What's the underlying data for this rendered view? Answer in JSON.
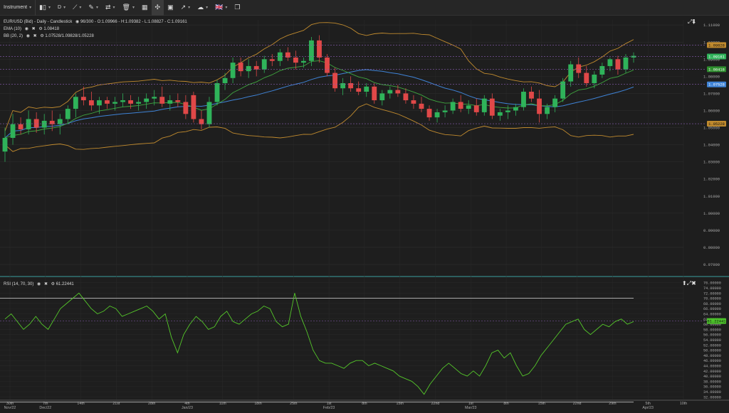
{
  "toolbar": {
    "instrument": "Instrument",
    "timeframe": "D",
    "flag": "🇬🇧"
  },
  "legend": {
    "title": "EUR/USD (Bid) - Daily - Candlestick",
    "bars": "96/300",
    "ohlc": "O:1.09966 - H:1.09382 - L:1.08827 - C:1.09161",
    "ema_label": "EMA (10)",
    "ema_value": "1.08418",
    "bb_label": "BB (20, 2)",
    "bb_value": "1.07528/1.09828/1.05228",
    "rsi_label": "RSI (14, 70, 30)",
    "rsi_value": "61.22441"
  },
  "price_axis": {
    "ticks": [
      "1.11000",
      "1.10000",
      "1.09000",
      "1.08000",
      "1.07000",
      "1.06000",
      "1.05000",
      "1.04000",
      "1.03000",
      "1.02000",
      "1.01000",
      "1.00000",
      "0.99000",
      "0.98000",
      "0.97000"
    ],
    "bb_upper": "1.09828",
    "last": "1.09161",
    "ema": "1.08418",
    "bb_mid": "1.07528",
    "bb_lower": "1.05228"
  },
  "rsi_axis": {
    "ticks": [
      "76.00000",
      "74.00000",
      "72.00000",
      "70.00000",
      "68.00000",
      "66.00000",
      "64.00000",
      "62.00000",
      "60.00000",
      "58.00000",
      "56.00000",
      "54.00000",
      "52.00000",
      "50.00000",
      "48.00000",
      "46.00000",
      "44.00000",
      "42.00000",
      "40.00000",
      "38.00000",
      "36.00000",
      "34.00000",
      "32.00000"
    ],
    "current": "61.22441"
  },
  "time_axis": [
    {
      "label": "30th\nNov/22"
    },
    {
      "label": "7th\nDec/22"
    },
    {
      "label": "14th"
    },
    {
      "label": "21st"
    },
    {
      "label": "28th"
    },
    {
      "label": "4th\nJan/23"
    },
    {
      "label": "11th"
    },
    {
      "label": "18th"
    },
    {
      "label": "25th"
    },
    {
      "label": "1st\nFeb/23"
    },
    {
      "label": "8th"
    },
    {
      "label": "15th"
    },
    {
      "label": "22nd"
    },
    {
      "label": "1st\nMar/23"
    },
    {
      "label": "8th"
    },
    {
      "label": "15th"
    },
    {
      "label": "22nd"
    },
    {
      "label": "29th"
    },
    {
      "label": "5th\nApr/23"
    },
    {
      "label": "10th"
    }
  ],
  "colors": {
    "up": "#2fb35a",
    "down": "#e04848",
    "ema": "#3fa63f",
    "bb_band": "#c08a2e",
    "bb_mid": "#3f83d6",
    "rsi": "#55c82a",
    "accent_teal": "#3aa0a0"
  },
  "chart_data": {
    "type": "candlestick",
    "price_range": [
      0.965,
      1.113
    ],
    "rsi_range": [
      31,
      77
    ],
    "rsi_levels": [
      70,
      30
    ],
    "candles": [
      [
        1.036,
        1.05,
        1.03,
        1.044
      ],
      [
        1.044,
        1.058,
        1.04,
        1.052
      ],
      [
        1.052,
        1.056,
        1.046,
        1.049
      ],
      [
        1.049,
        1.06,
        1.046,
        1.055
      ],
      [
        1.055,
        1.059,
        1.047,
        1.05
      ],
      [
        1.05,
        1.058,
        1.046,
        1.054
      ],
      [
        1.054,
        1.06,
        1.048,
        1.052
      ],
      [
        1.052,
        1.058,
        1.046,
        1.055
      ],
      [
        1.055,
        1.063,
        1.052,
        1.061
      ],
      [
        1.061,
        1.07,
        1.056,
        1.068
      ],
      [
        1.068,
        1.074,
        1.063,
        1.066
      ],
      [
        1.066,
        1.071,
        1.06,
        1.063
      ],
      [
        1.063,
        1.068,
        1.058,
        1.066
      ],
      [
        1.066,
        1.068,
        1.061,
        1.064
      ],
      [
        1.064,
        1.068,
        1.06,
        1.065
      ],
      [
        1.065,
        1.07,
        1.062,
        1.066
      ],
      [
        1.066,
        1.069,
        1.061,
        1.064
      ],
      [
        1.064,
        1.068,
        1.06,
        1.065
      ],
      [
        1.065,
        1.07,
        1.061,
        1.067
      ],
      [
        1.067,
        1.072,
        1.063,
        1.068
      ],
      [
        1.068,
        1.074,
        1.062,
        1.064
      ],
      [
        1.064,
        1.069,
        1.06,
        1.066
      ],
      [
        1.066,
        1.07,
        1.062,
        1.065
      ],
      [
        1.065,
        1.069,
        1.055,
        1.058
      ],
      [
        1.069,
        1.071,
        1.053,
        1.055
      ],
      [
        1.055,
        1.06,
        1.049,
        1.052
      ],
      [
        1.052,
        1.068,
        1.05,
        1.065
      ],
      [
        1.065,
        1.078,
        1.063,
        1.076
      ],
      [
        1.076,
        1.082,
        1.072,
        1.079
      ],
      [
        1.079,
        1.091,
        1.076,
        1.088
      ],
      [
        1.088,
        1.091,
        1.08,
        1.083
      ],
      [
        1.083,
        1.09,
        1.079,
        1.086
      ],
      [
        1.086,
        1.089,
        1.08,
        1.084
      ],
      [
        1.084,
        1.092,
        1.082,
        1.09
      ],
      [
        1.09,
        1.093,
        1.086,
        1.089
      ],
      [
        1.089,
        1.096,
        1.086,
        1.094
      ],
      [
        1.094,
        1.097,
        1.089,
        1.091
      ],
      [
        1.091,
        1.095,
        1.084,
        1.088
      ],
      [
        1.088,
        1.091,
        1.085,
        1.089
      ],
      [
        1.089,
        1.103,
        1.086,
        1.101
      ],
      [
        1.101,
        1.104,
        1.088,
        1.091
      ],
      [
        1.091,
        1.093,
        1.08,
        1.082
      ],
      [
        1.082,
        1.085,
        1.071,
        1.073
      ],
      [
        1.073,
        1.079,
        1.069,
        1.076
      ],
      [
        1.076,
        1.08,
        1.071,
        1.073
      ],
      [
        1.073,
        1.077,
        1.069,
        1.071
      ],
      [
        1.071,
        1.076,
        1.068,
        1.074
      ],
      [
        1.074,
        1.076,
        1.064,
        1.066
      ],
      [
        1.066,
        1.072,
        1.063,
        1.07
      ],
      [
        1.07,
        1.074,
        1.067,
        1.072
      ],
      [
        1.072,
        1.075,
        1.068,
        1.07
      ],
      [
        1.07,
        1.073,
        1.064,
        1.066
      ],
      [
        1.066,
        1.069,
        1.061,
        1.064
      ],
      [
        1.064,
        1.068,
        1.059,
        1.061
      ],
      [
        1.061,
        1.063,
        1.054,
        1.056
      ],
      [
        1.056,
        1.061,
        1.053,
        1.059
      ],
      [
        1.059,
        1.063,
        1.056,
        1.06
      ],
      [
        1.06,
        1.067,
        1.058,
        1.065
      ],
      [
        1.065,
        1.069,
        1.059,
        1.061
      ],
      [
        1.061,
        1.066,
        1.058,
        1.063
      ],
      [
        1.063,
        1.067,
        1.057,
        1.059
      ],
      [
        1.059,
        1.069,
        1.057,
        1.067
      ],
      [
        1.067,
        1.07,
        1.055,
        1.057
      ],
      [
        1.057,
        1.061,
        1.054,
        1.059
      ],
      [
        1.059,
        1.063,
        1.055,
        1.06
      ],
      [
        1.06,
        1.064,
        1.057,
        1.062
      ],
      [
        1.062,
        1.073,
        1.06,
        1.071
      ],
      [
        1.071,
        1.074,
        1.065,
        1.067
      ],
      [
        1.067,
        1.072,
        1.053,
        1.058
      ],
      [
        1.058,
        1.064,
        1.055,
        1.062
      ],
      [
        1.062,
        1.069,
        1.059,
        1.067
      ],
      [
        1.067,
        1.079,
        1.065,
        1.077
      ],
      [
        1.077,
        1.089,
        1.074,
        1.087
      ],
      [
        1.087,
        1.091,
        1.079,
        1.082
      ],
      [
        1.082,
        1.086,
        1.074,
        1.076
      ],
      [
        1.076,
        1.083,
        1.073,
        1.081
      ],
      [
        1.081,
        1.088,
        1.079,
        1.086
      ],
      [
        1.086,
        1.091,
        1.083,
        1.09
      ],
      [
        1.09,
        1.092,
        1.081,
        1.084
      ],
      [
        1.084,
        1.093,
        1.082,
        1.091
      ],
      [
        1.091,
        1.094,
        1.088,
        1.092
      ]
    ],
    "rsi": [
      62,
      64,
      61,
      58,
      60,
      63,
      60,
      58,
      62,
      66,
      68,
      70,
      72,
      69,
      66,
      64,
      65,
      67,
      66,
      63,
      64,
      65,
      66,
      67,
      65,
      62,
      64,
      55,
      49,
      56,
      60,
      63,
      61,
      58,
      59,
      63,
      65,
      61,
      60,
      62,
      64,
      65,
      67,
      66,
      61,
      59,
      60,
      72,
      63,
      57,
      50,
      46,
      45,
      45,
      44,
      43,
      45,
      46,
      46,
      44,
      45,
      44,
      43,
      42,
      40,
      39,
      38,
      36,
      33,
      37,
      40,
      43,
      45,
      43,
      41,
      40,
      42,
      40,
      44,
      49,
      50,
      47,
      49,
      44,
      40,
      41,
      44,
      48,
      51,
      54,
      57,
      60,
      61,
      62,
      58,
      56,
      58,
      60,
      59,
      61,
      62,
      60,
      61
    ]
  }
}
